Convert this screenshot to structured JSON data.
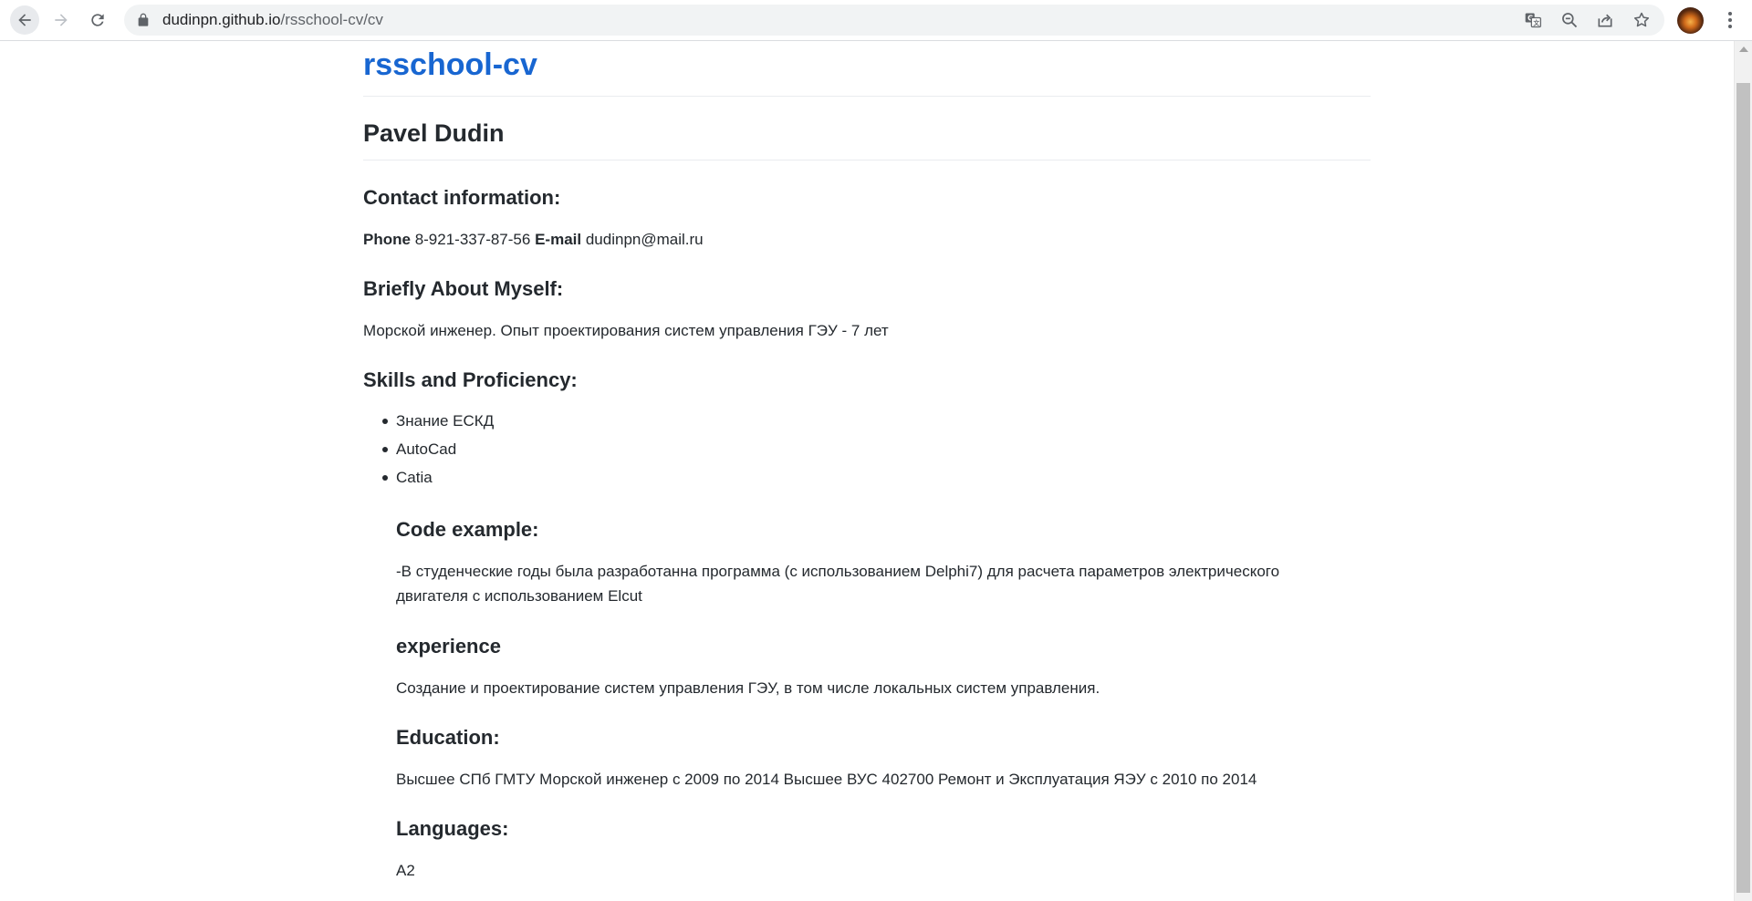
{
  "browser": {
    "url_domain": "dudinpn.github.io",
    "url_path": "/rsschool-cv/cv",
    "icons": {
      "back": "arrow-left-icon",
      "forward": "arrow-right-icon",
      "reload": "reload-icon",
      "lock": "lock-icon",
      "translate": "translate-icon",
      "zoom": "zoom-out-icon",
      "share": "share-icon",
      "bookmark": "star-icon",
      "menu": "more-vert-icon"
    }
  },
  "page": {
    "site_title": "rsschool-cv",
    "name": "Pavel Dudin",
    "contact": {
      "heading": "Contact information:",
      "phone_label": "Phone",
      "phone_value": "8-921-337-87-56",
      "email_label": "E-mail",
      "email_value": "dudinpn@mail.ru"
    },
    "about": {
      "heading": "Briefly About Myself:",
      "text": "Морской инженер. Опыт проектирования систем управления ГЭУ - 7 лет"
    },
    "skills": {
      "heading": "Skills and Proficiency:",
      "items": [
        "Знание ЕСКД",
        "AutoCad",
        "Catia"
      ]
    },
    "code_example": {
      "heading": "Code example:",
      "text": "-В студенческие годы была разработанна программа (с использованием Delphi7) для расчета параметров электрического двигателя с использованием Elcut"
    },
    "experience": {
      "heading": "experience",
      "text": "Создание и проектирование систем управления ГЭУ, в том числе локальных систем управления."
    },
    "education": {
      "heading": "Education:",
      "text": "Высшее СПб ГМТУ Морской инженер с 2009 по 2014 Высшее ВУС 402700 Ремонт и Эксплуатация ЯЭУ с 2010 по 2014"
    },
    "languages": {
      "heading": "Languages:",
      "text": "A2"
    }
  },
  "colors": {
    "link": "#1866d1",
    "text": "#24292e",
    "rule": "#eaecef"
  }
}
